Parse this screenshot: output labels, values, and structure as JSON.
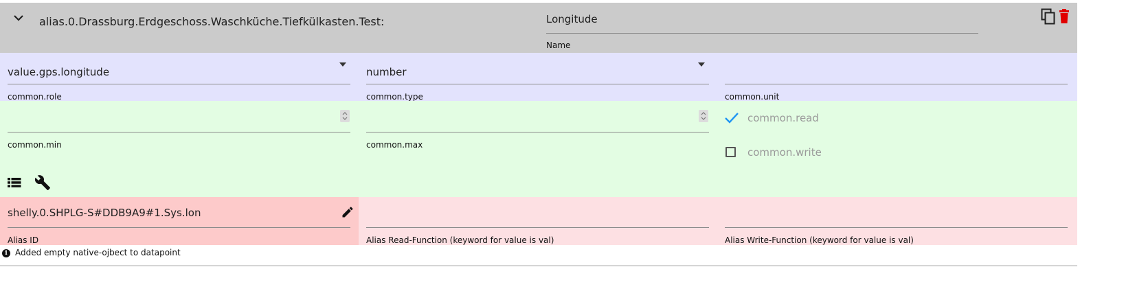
{
  "header": {
    "collapse_icon": "chevron-down-icon",
    "alias_path": "alias.0.Drassburg.Erdgeschoss.Waschküche.Tiefkülkasten.Test:",
    "name_value": "Longitude",
    "name_label": "Name",
    "copy_icon": "copy-icon",
    "delete_icon": "delete-icon",
    "delete_color": "#e00000"
  },
  "common": {
    "role": {
      "value": "value.gps.longitude",
      "label": "common.role"
    },
    "type": {
      "value": "number",
      "label": "common.type"
    },
    "unit": {
      "value": "",
      "label": "common.unit"
    },
    "min": {
      "value": "",
      "label": "common.min"
    },
    "max": {
      "value": "",
      "label": "common.max"
    },
    "read": {
      "label": "common.read",
      "checked": true
    },
    "write": {
      "label": "common.write",
      "checked": false
    }
  },
  "toolbar": {
    "list_icon": "list-icon",
    "wrench_icon": "wrench-icon"
  },
  "alias": {
    "id_value": "shelly.0.SHPLG-S#DDB9A9#1.Sys.lon",
    "id_label": "Alias ID",
    "edit_icon": "pencil-icon",
    "read_function_value": "",
    "read_function_label": "Alias Read-Function (keyword for value is val)",
    "write_function_value": "",
    "write_function_label": "Alias Write-Function (keyword for value is val)"
  },
  "status": {
    "icon": "info-icon",
    "message": "Added empty native-ojbect to datapoint"
  },
  "colors": {
    "header_bg": "#cbcbcb",
    "row_blue": "#e3e3fd",
    "row_green": "#e3fde3",
    "row_pink": "#fde0e3",
    "row_pink_dark": "#fdcaca",
    "check_accent": "#2196f3"
  }
}
